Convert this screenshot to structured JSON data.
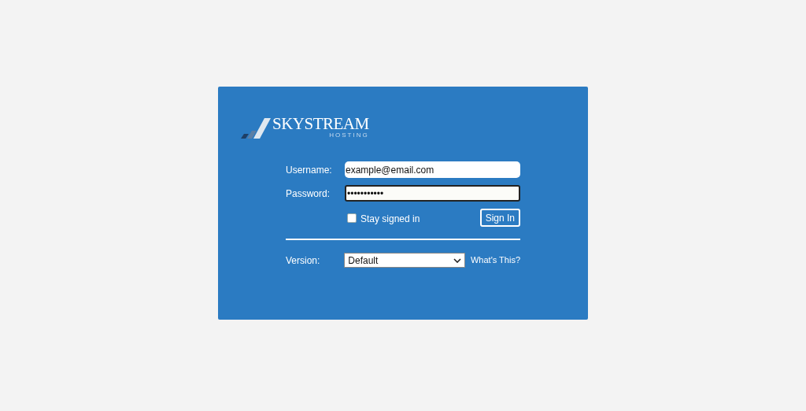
{
  "logo": {
    "name": "SKYSTREAM",
    "tagline": "HOSTING"
  },
  "username": {
    "label": "Username:",
    "value": "example@email.com"
  },
  "password": {
    "label": "Password:",
    "value": "•••••••••••",
    "focused": true
  },
  "stay_signed_in": {
    "label": "Stay signed in",
    "checked": false
  },
  "sign_in_button": "Sign In",
  "version": {
    "label": "Version:",
    "value": "Default"
  },
  "whats_this_link": "What's This?"
}
